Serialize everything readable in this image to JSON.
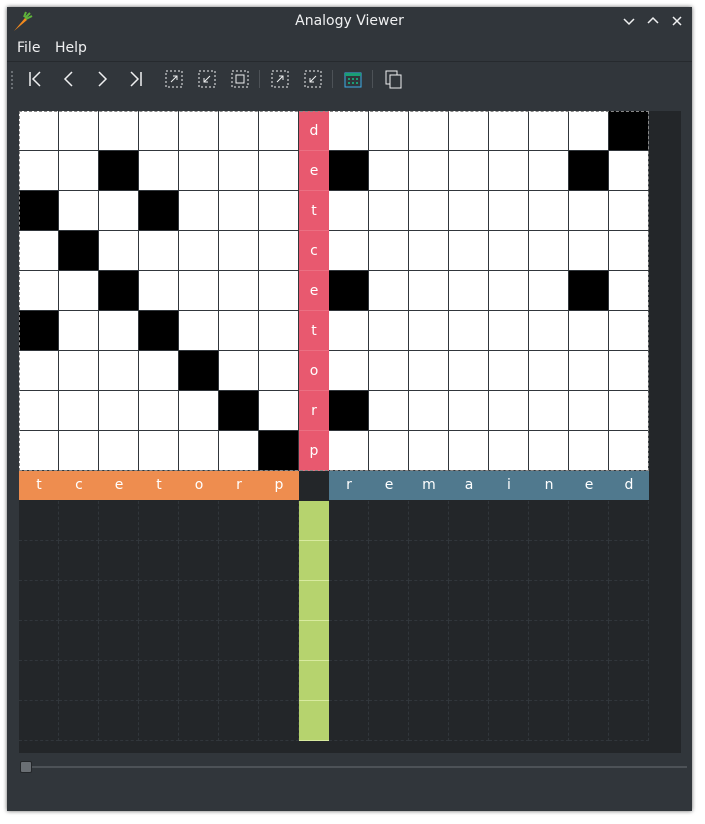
{
  "window": {
    "title": "Analogy Viewer",
    "icons": {
      "app": "carrot-icon",
      "minimize": "chevron-down-icon",
      "maximize": "chevron-up-icon",
      "close": "close-icon"
    }
  },
  "menu": {
    "file": "File",
    "help": "Help"
  },
  "toolbar": {
    "buttons": [
      "first-icon",
      "previous-icon",
      "next-icon",
      "last-icon",
      "zoom-fit-icon",
      "zoom-shrink-icon",
      "zoom-original-icon",
      "zoom-in-selection-icon",
      "zoom-out-selection-icon",
      "calendar-icon",
      "copy-icon"
    ]
  },
  "puzzle": {
    "vertical_word": [
      "d",
      "e",
      "t",
      "c",
      "e",
      "t",
      "o",
      "r",
      "p"
    ],
    "left_word": [
      "t",
      "c",
      "e",
      "t",
      "o",
      "r",
      "p"
    ],
    "right_word": [
      "r",
      "e",
      "m",
      "a",
      "i",
      "n",
      "e",
      "d"
    ],
    "black_cells": [
      [
        0,
        15
      ],
      [
        1,
        2
      ],
      [
        1,
        8
      ],
      [
        1,
        14
      ],
      [
        2,
        0
      ],
      [
        2,
        3
      ],
      [
        3,
        1
      ],
      [
        4,
        2
      ],
      [
        4,
        8
      ],
      [
        4,
        14
      ],
      [
        5,
        0
      ],
      [
        5,
        3
      ],
      [
        6,
        4
      ],
      [
        7,
        5
      ],
      [
        7,
        8
      ],
      [
        8,
        6
      ]
    ],
    "green_cells": 6
  },
  "colors": {
    "vertical": "#e8596f",
    "left": "#ee8d4f",
    "right": "#50798e",
    "green": "#b6d36e",
    "background": "#31363b"
  }
}
